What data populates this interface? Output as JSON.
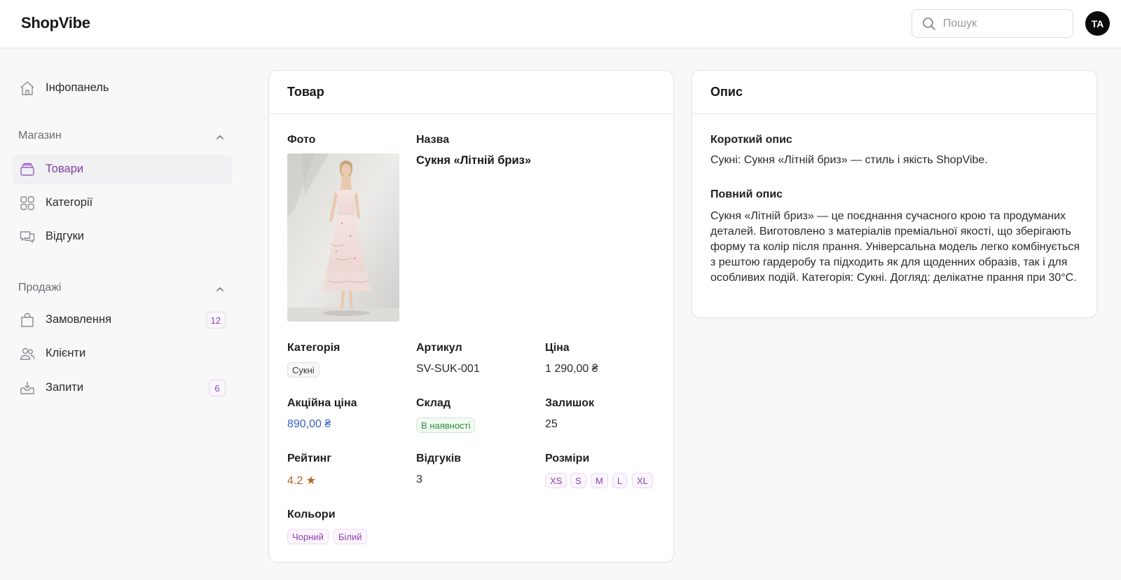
{
  "app": {
    "name": "ShopVibe"
  },
  "header": {
    "search_placeholder": "Пошук",
    "avatar_initials": "TA"
  },
  "sidebar": {
    "dashboard": "Інфопанель",
    "shop_section": "Магазин",
    "products": "Товари",
    "categories": "Категорії",
    "reviews": "Відгуки",
    "sales_section": "Продажі",
    "orders": "Замовлення",
    "orders_badge": "12",
    "customers": "Клієнти",
    "requests": "Запити",
    "requests_badge": "6"
  },
  "product_card": {
    "title": "Товар",
    "photo_label": "Фото",
    "name_label": "Назва",
    "name": "Сукня «Літній бриз»",
    "category_label": "Категорія",
    "category": "Сукні",
    "sku_label": "Артикул",
    "sku": "SV-SUK-001",
    "price_label": "Ціна",
    "price": "1 290,00 ₴",
    "sale_label": "Акційна ціна",
    "sale_price": "890,00 ₴",
    "stock_label": "Склад",
    "stock_status": "В наявності",
    "remaining_label": "Залишок",
    "remaining": "25",
    "rating_label": "Рейтинг",
    "rating": "4.2 ★",
    "reviews_label": "Відгуків",
    "reviews": "3",
    "sizes_label": "Розміри",
    "sizes": [
      "XS",
      "S",
      "M",
      "L",
      "XL"
    ],
    "colors_label": "Кольори",
    "colors": [
      "Чорний",
      "Білий"
    ]
  },
  "description_card": {
    "title": "Опис",
    "short_label": "Короткий опис",
    "short": "Сукні: Сукня «Літній бриз» — стиль і якість ShopVibe.",
    "full_label": "Повний опис",
    "full": "Сукня «Літній бриз» — це поєднання сучасного крою та продуманих деталей. Виготовлено з матеріалів преміальної якості, що зберігають форму та колір після прання. Універсальна модель легко комбінується з рештою гардеробу та підходить як для щоденних образів, так і для особливих подій. Категорія: Сукні. Догляд: делікатне прання при 30°C."
  },
  "colors": {
    "accent": "#7b3fa3",
    "sale_price": "#3a5fc4",
    "rating": "#b5651d",
    "in_stock": "#2f8a3c"
  },
  "icons": {
    "dashboard": "home-icon",
    "products": "stack-icon",
    "categories": "grid-icon",
    "reviews": "chat-icon",
    "orders": "shopping-bag-icon",
    "customers": "users-icon",
    "requests": "inbox-icon",
    "search": "search-icon",
    "collapse": "chevron-up-icon"
  }
}
